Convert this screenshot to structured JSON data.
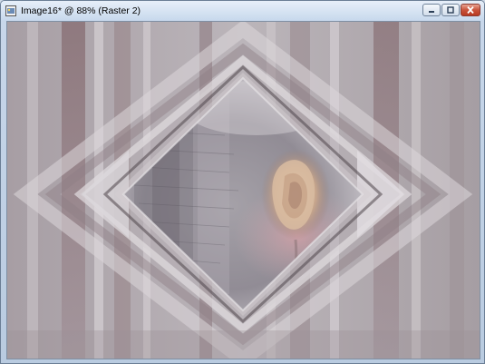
{
  "window": {
    "title": "Image16* @  88% (Raster 2)",
    "app_icon": "paint-shop-pro-icon",
    "controls": {
      "minimize_icon": "minimize-icon",
      "maximize_icon": "maximize-icon",
      "close_icon": "close-icon"
    }
  },
  "canvas": {
    "content": "abstract-artwork-rose-diamond",
    "colors": {
      "base": "#b3acb2",
      "mauve": "#8f7b7f",
      "light": "#d8d3d8",
      "dark": "#6f6266",
      "rose": "#c9a9a8"
    }
  }
}
